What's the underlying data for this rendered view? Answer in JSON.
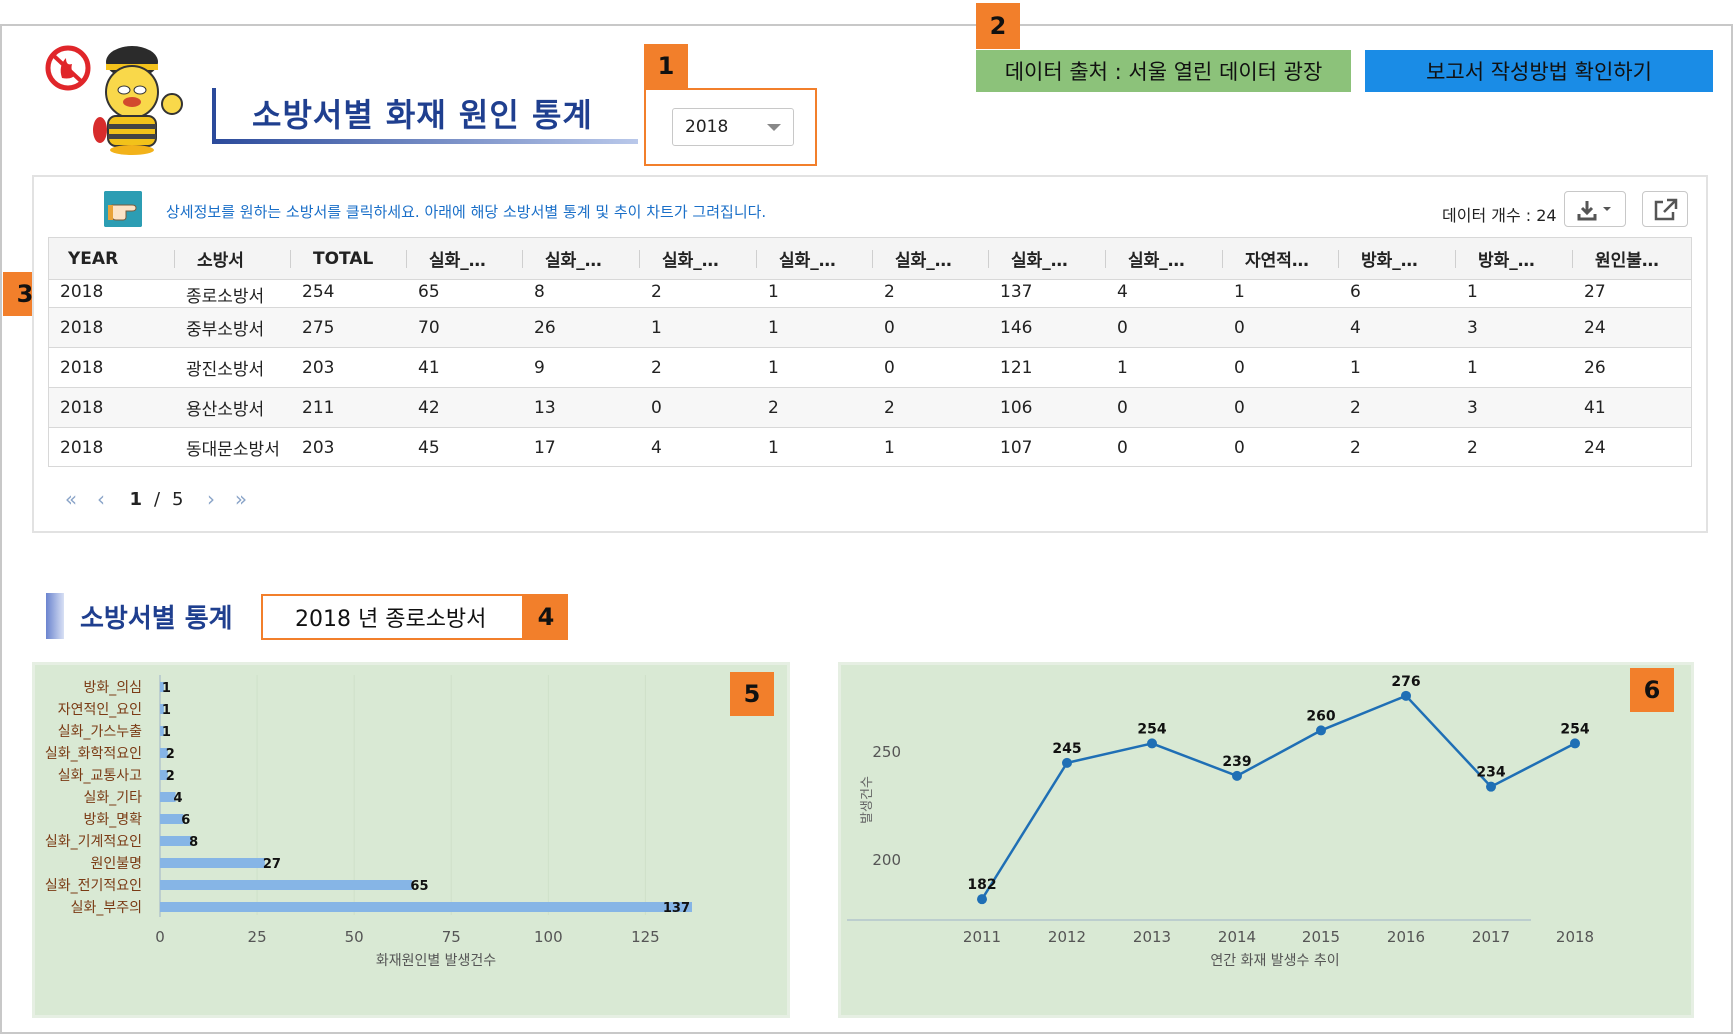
{
  "header": {
    "title": "소방서별 화재 원인 통계",
    "year_selected": "2018",
    "source_button": "데이터 출처 : 서울 열린 데이터 광장",
    "guide_button": "보고서 작성방법 확인하기"
  },
  "markers": [
    "1",
    "2",
    "3",
    "4",
    "5",
    "6"
  ],
  "table_panel": {
    "hint": "상세정보를 원하는 소방서를 클릭하세요. 아래에 해당 소방서별 통계 및 추이  차트가 그려집니다.",
    "count_label": "데이터 개수 : 24",
    "columns": [
      "YEAR",
      "소방서",
      "TOTAL",
      "실화_…",
      "실화_…",
      "실화_…",
      "실화_…",
      "실화_…",
      "실화_…",
      "실화_…",
      "자연적…",
      "방화_…",
      "방화_…",
      "원인불…"
    ],
    "rows": [
      [
        "2018",
        "종로소방서",
        "254",
        "65",
        "8",
        "2",
        "1",
        "2",
        "137",
        "4",
        "1",
        "6",
        "1",
        "27"
      ],
      [
        "2018",
        "중부소방서",
        "275",
        "70",
        "26",
        "1",
        "1",
        "0",
        "146",
        "0",
        "0",
        "4",
        "3",
        "24"
      ],
      [
        "2018",
        "광진소방서",
        "203",
        "41",
        "9",
        "2",
        "1",
        "0",
        "121",
        "1",
        "0",
        "1",
        "1",
        "26"
      ],
      [
        "2018",
        "용산소방서",
        "211",
        "42",
        "13",
        "0",
        "2",
        "2",
        "106",
        "0",
        "0",
        "2",
        "3",
        "41"
      ],
      [
        "2018",
        "동대문소방서",
        "203",
        "45",
        "17",
        "4",
        "1",
        "1",
        "107",
        "0",
        "0",
        "2",
        "2",
        "24"
      ]
    ],
    "pager": {
      "current": "1",
      "separator": "/",
      "total": "5"
    }
  },
  "station_section": {
    "title": "소방서별 통계",
    "selected": "2018 년 종로소방서"
  },
  "colors": {
    "accent_orange": "#f27f2b",
    "chart_bg": "#d9e9d4",
    "bar": "#86b5e6",
    "line": "#1f6fb5",
    "title_blue": "#1f3f8f"
  },
  "chart_data": [
    {
      "type": "bar",
      "orientation": "horizontal",
      "categories": [
        "방화_의심",
        "자연적인_요인",
        "실화_가스누출",
        "실화_화학적요인",
        "실화_교통사고",
        "실화_기타",
        "방화_명확",
        "실화_기계적요인",
        "원인불명",
        "실화_전기적요인",
        "실화_부주의"
      ],
      "values": [
        1,
        1,
        1,
        2,
        2,
        4,
        6,
        8,
        27,
        65,
        137
      ],
      "xlabel": "화재원인별 발생건수",
      "ylabel": "",
      "xlim": [
        0,
        137
      ],
      "xticks": [
        "0",
        "25",
        "50",
        "75",
        "100",
        "125"
      ],
      "grid": true
    },
    {
      "type": "line",
      "x": [
        "2011",
        "2012",
        "2013",
        "2014",
        "2015",
        "2016",
        "2017",
        "2018"
      ],
      "values": [
        182,
        245,
        254,
        239,
        260,
        276,
        234,
        254
      ],
      "xlabel": "연간 화재 발생수 추이",
      "ylabel": "발생건수",
      "ylim": [
        177,
        281
      ],
      "yticks": [
        "200",
        "250"
      ],
      "grid": false
    }
  ]
}
